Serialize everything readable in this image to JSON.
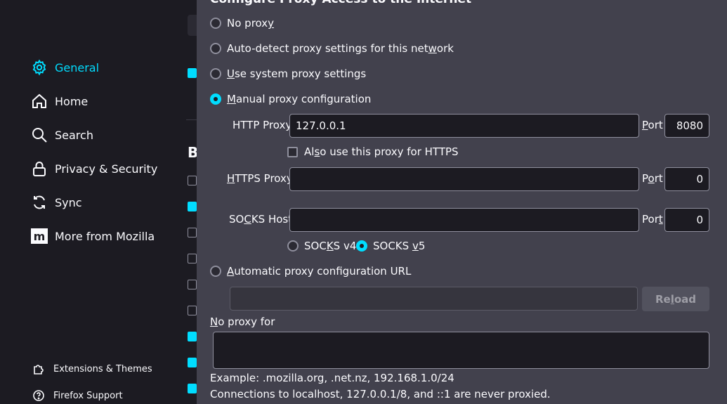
{
  "sidebar": {
    "items": [
      {
        "label": "General",
        "icon": "gear-icon",
        "active": true
      },
      {
        "label": "Home",
        "icon": "home-icon"
      },
      {
        "label": "Search",
        "icon": "search-icon"
      },
      {
        "label": "Privacy & Security",
        "icon": "lock-icon"
      },
      {
        "label": "Sync",
        "icon": "sync-icon"
      },
      {
        "label": "More from Mozilla",
        "icon": "mozilla-logo-icon"
      }
    ],
    "footer": [
      {
        "label": "Extensions & Themes",
        "icon": "puzzle-icon"
      },
      {
        "label": "Firefox Support",
        "icon": "help-icon"
      }
    ]
  },
  "background": {
    "heading_fragment": "B"
  },
  "dialog": {
    "heading": "Configure Proxy Access to the Internet",
    "options": {
      "no_proxy": {
        "pre": "No prox",
        "key": "y",
        "post": ""
      },
      "auto_detect": {
        "pre": "Auto-detect proxy settings for this net",
        "key": "w",
        "post": "ork"
      },
      "system": {
        "pre": "",
        "key": "U",
        "post": "se system proxy settings"
      },
      "manual": {
        "pre": "",
        "key": "M",
        "post": "anual proxy configuration",
        "selected": true
      },
      "auto_url": {
        "pre": "",
        "key": "A",
        "post": "utomatic proxy configuration URL"
      }
    },
    "http": {
      "label_pre": "HTTP Prox",
      "label_key": "y",
      "value": "127.0.0.1",
      "port_label_key": "P",
      "port_label_post": "ort",
      "port_value": "8080"
    },
    "also_https": {
      "pre": "Al",
      "key": "s",
      "post": "o use this proxy for HTTPS"
    },
    "https": {
      "label_pre": "",
      "label_key": "H",
      "label_post": "TTPS Proxy",
      "value": "",
      "port_label_pre": "P",
      "port_label_key": "o",
      "port_label_post": "rt",
      "port_value": "0"
    },
    "socks": {
      "label_pre": "SO",
      "label_key": "C",
      "label_post": "KS Host",
      "value": "",
      "port_label_pre": "Por",
      "port_label_key": "t",
      "port_value": "0",
      "v4": {
        "pre": "SOC",
        "key": "K",
        "post": "S v4"
      },
      "v5": {
        "pre": "SOCKS ",
        "key": "v",
        "post": "5",
        "selected": true
      }
    },
    "auto_url_value": "",
    "reload": {
      "pre": "Re",
      "key": "l",
      "post": "oad"
    },
    "no_proxy_for": {
      "pre": "",
      "key": "N",
      "post": "o proxy for"
    },
    "example": "Example: .mozilla.org, .net.nz, 192.168.1.0/24",
    "localhost_note": "Connections to localhost, 127.0.0.1/8, and ::1 are never proxied."
  },
  "colors": {
    "accent": "#00ddff",
    "dialog_bg": "#42414d",
    "page_bg": "#1c1b22"
  }
}
